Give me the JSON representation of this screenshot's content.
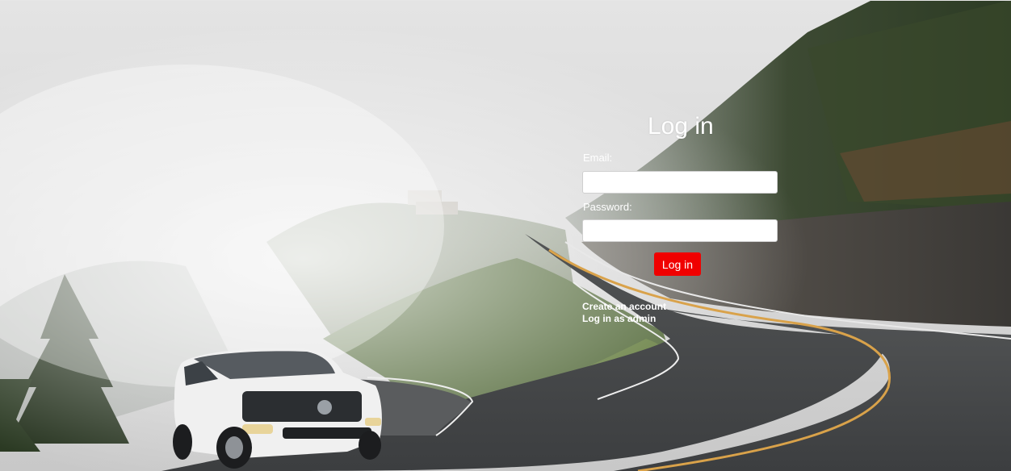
{
  "login": {
    "title": "Log in",
    "email_label": "Email:",
    "email_value": "",
    "password_label": "Password:",
    "password_value": "",
    "submit_label": "Log in",
    "create_account_link": "Create an account",
    "admin_login_link": "Log in as admin"
  },
  "colors": {
    "button": "#f00000",
    "text": "#ffffff",
    "input_background": "#ffffff"
  }
}
